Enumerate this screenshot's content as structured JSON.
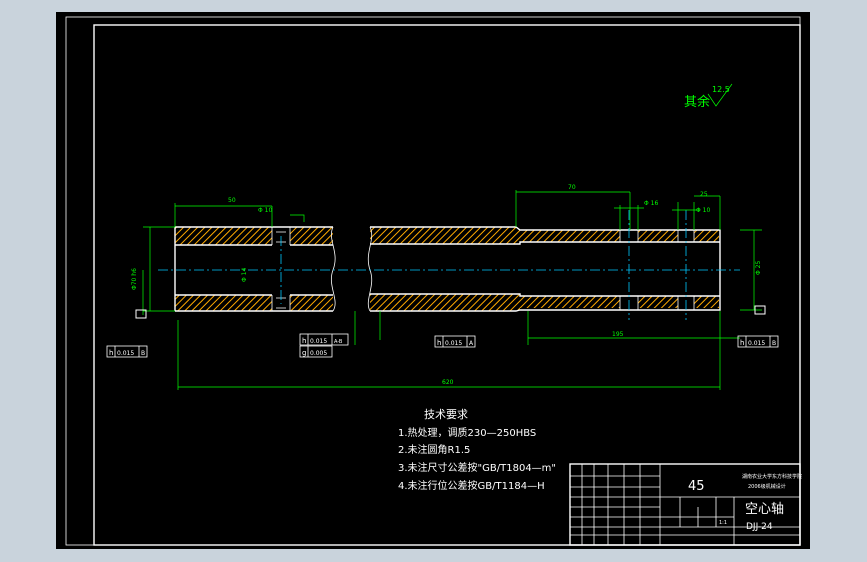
{
  "colors": {
    "background": "#c9d3dc",
    "sheet": "#000000",
    "outline": "#ffffff",
    "dimension": "#00ff00",
    "centerline": "#00c8ff",
    "hatch": "#ffaa00"
  },
  "roughness": {
    "label": "其余",
    "value": "12.5"
  },
  "dimensions": {
    "left_length": "50",
    "left_groove_dia": "Φ 10",
    "mid_length": "70",
    "right_groove_dia1": "Φ 16",
    "right_groove_dia2": "Φ 10",
    "right_small": "25",
    "length_195": "195",
    "total_length": "620",
    "right_dia": "Φ 25",
    "left_dia": "Φ70 h6",
    "bore_dia": "Φ 14"
  },
  "tolerances": {
    "left": {
      "symbol": "h",
      "value": "0.015",
      "datum": "B"
    },
    "mid_a": {
      "symbol": "h",
      "value": "0.015",
      "datum": "A-B"
    },
    "mid_b": {
      "symbol": "g",
      "value": "0.005"
    },
    "mid_c": {
      "symbol": "h",
      "value": "0.015",
      "datum": "A"
    },
    "right": {
      "symbol": "h",
      "value": "0.015",
      "datum": "B"
    }
  },
  "notes": {
    "title": "技术要求",
    "items": [
      "1.热处理，调质230—250HBS",
      "2.未注圆角R1.5",
      "3.未注尺寸公差按\"GB/T1804—m\"",
      "4.未注行位公差按GB/T1184—H"
    ]
  },
  "title_block": {
    "material": "45",
    "school": "湖南农业大学东方科技学院",
    "class_name": "2006级机械设计",
    "part_name": "空心轴",
    "drawing_no": "DJJ-24",
    "scale": "1:1"
  }
}
